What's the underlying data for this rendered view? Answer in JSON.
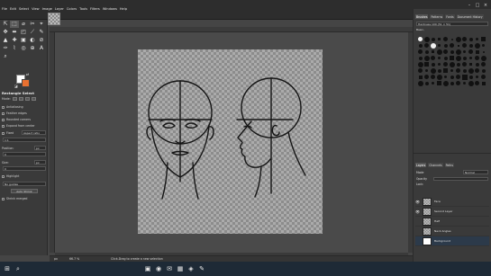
{
  "menubar": {
    "items": [
      "File",
      "Edit",
      "Select",
      "View",
      "Image",
      "Layer",
      "Colors",
      "Tools",
      "Filters",
      "Windows",
      "Help"
    ],
    "window_controls": [
      "–",
      "□",
      "×"
    ]
  },
  "toolbox": {
    "tools": [
      "⇱",
      "⬚",
      "⌀",
      "✂",
      "⌖",
      "✥",
      "⬌",
      "◰",
      "⟋",
      "✎",
      "▲",
      "✚",
      "▣",
      "◐",
      "⊘",
      "✑",
      "⌇",
      "◎",
      "⊕",
      "A",
      "⌕",
      "⋯",
      "",
      "",
      ""
    ],
    "active_tool_index": 1,
    "colors": {
      "fg": "#ffffff",
      "bg": "#e87030"
    },
    "options": {
      "title": "Rectangle Select",
      "mode_label": "Mode:",
      "antialiasing": "Antialiasing",
      "feather_edges": "Feather edges",
      "rounded_corners": "Rounded corners",
      "expand_from_center": "Expand from center",
      "fixed_label": "Fixed",
      "fixed_value": "Aspect ratio",
      "ratio_value": "1:1",
      "position_label": "Position:",
      "position_unit": "px",
      "position_value": "0",
      "size_label": "Size:",
      "size_unit": "px",
      "size_value": "0",
      "highlight": "Highlight",
      "guides_value": "No guides",
      "auto_shrink": "Auto Shrink",
      "shrink_merged": "Shrink merged"
    }
  },
  "status": {
    "unit": "px",
    "zoom": "66.7 %",
    "message": "Click-Drag to create a new selection"
  },
  "dock": {
    "top_tabs": [
      "Brushes",
      "Patterns",
      "Fonts",
      "Document History"
    ],
    "brush_filter": "Hardness 100 (51 × 51)",
    "spacing_label": "Basic,",
    "layer_tabs": [
      "Layers",
      "Channels",
      "Paths"
    ],
    "mode_label": "Mode",
    "mode_value": "Normal",
    "opacity_label": "Opacity",
    "lock_label": "Lock:",
    "layers": [
      {
        "name": "Face",
        "visible": true,
        "white": false
      },
      {
        "name": "Second Layer",
        "visible": true,
        "white": false
      },
      {
        "name": "Half",
        "visible": false,
        "white": false
      },
      {
        "name": "Neck Angles",
        "visible": false,
        "white": false
      },
      {
        "name": "Background",
        "visible": false,
        "white": true
      }
    ]
  },
  "taskbar": {
    "icons": [
      "⊞",
      "⌕",
      "▣",
      "◉",
      "✉",
      "▦",
      "◈",
      "✎"
    ]
  }
}
